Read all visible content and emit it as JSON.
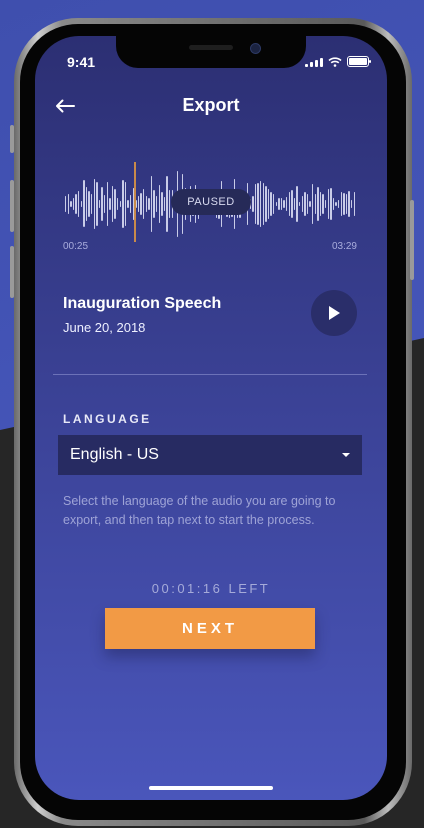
{
  "colors": {
    "background_top": "#4a5bc2",
    "background_bottom": "#262626",
    "screen_gradient_top": "#2c2f73",
    "screen_gradient_bottom": "#4a56bb",
    "accent": "#f29a45",
    "control_dark": "#272b62"
  },
  "status_bar": {
    "time": "9:41",
    "icons": [
      "signal-icon",
      "wifi-icon",
      "battery-icon"
    ]
  },
  "header": {
    "back_icon": "arrow-left-icon",
    "title": "Export"
  },
  "player": {
    "state_label": "PAUSED",
    "elapsed": "00:25",
    "duration": "03:29",
    "progress": 0.12
  },
  "track": {
    "title": "Inauguration Speech",
    "date": "June 20, 2018",
    "play_icon": "play-icon"
  },
  "language": {
    "label": "LANGUAGE",
    "selected": "English - US",
    "dropdown_icon": "caret-down-icon",
    "helper_text": "Select the language of the audio you are going to export, and then tap next to start the process."
  },
  "footer": {
    "time_left": "00:01:16 LEFT",
    "next_label": "NEXT"
  }
}
